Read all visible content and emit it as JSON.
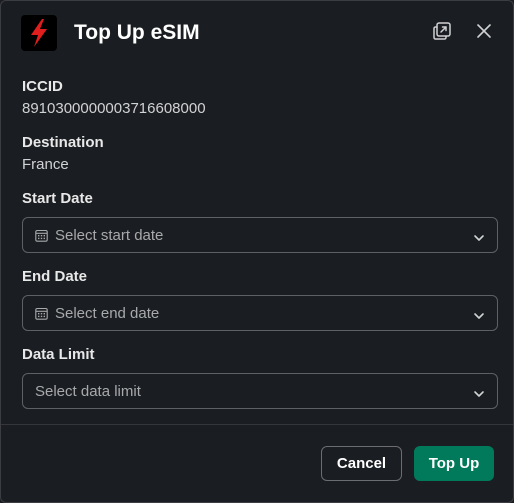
{
  "header": {
    "title": "Top Up eSIM",
    "app_icon": "lightning-bolt-icon",
    "popout_icon": "open-in-window-icon",
    "close_icon": "close-icon"
  },
  "details": {
    "iccid_label": "ICCID",
    "iccid_value": "8910300000003716608000",
    "destination_label": "Destination",
    "destination_value": "France"
  },
  "form": {
    "start_date": {
      "label": "Start Date",
      "placeholder": "Select start date",
      "icon": "calendar-icon"
    },
    "end_date": {
      "label": "End Date",
      "placeholder": "Select end date",
      "icon": "calendar-icon"
    },
    "data_limit": {
      "label": "Data Limit",
      "placeholder": "Select data limit"
    }
  },
  "footer": {
    "cancel_label": "Cancel",
    "submit_label": "Top Up"
  },
  "colors": {
    "background": "#1a1d21",
    "primary": "#007a5a",
    "bolt": "#e01e1e",
    "border": "#5e6066"
  }
}
